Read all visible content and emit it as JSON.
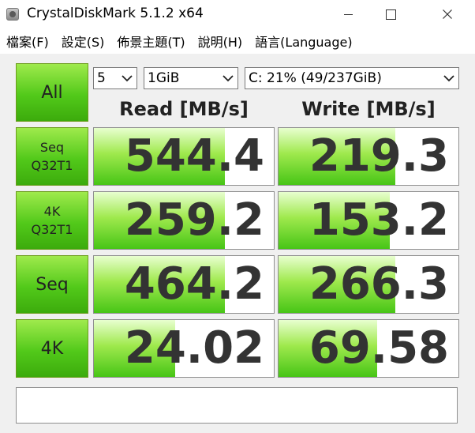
{
  "window": {
    "title": "CrystalDiskMark 5.1.2 x64"
  },
  "menu": [
    {
      "label": "檔案(F)"
    },
    {
      "label": "設定(S)"
    },
    {
      "label": "佈景主題(T)"
    },
    {
      "label": "說明(H)"
    },
    {
      "label": "語言(Language)"
    }
  ],
  "controls": {
    "all_label": "All",
    "count": "5",
    "size": "1GiB",
    "drive": "C: 21% (49/237GiB)"
  },
  "columns": {
    "read": "Read [MB/s]",
    "write": "Write [MB/s]"
  },
  "tests": [
    {
      "label": [
        "Seq",
        "Q32T1"
      ],
      "read": "544.4",
      "write": "219.3",
      "read_fill": 0.73,
      "write_fill": 0.65
    },
    {
      "label": [
        "4K",
        "Q32T1"
      ],
      "read": "259.2",
      "write": "153.2",
      "read_fill": 0.73,
      "write_fill": 0.62
    },
    {
      "label": [
        "Seq"
      ],
      "read": "464.2",
      "write": "266.3",
      "read_fill": 0.73,
      "write_fill": 0.65
    },
    {
      "label": [
        "4K"
      ],
      "read": "24.02",
      "write": "69.58",
      "read_fill": 0.45,
      "write_fill": 0.55
    }
  ],
  "status": "",
  "colors": {
    "accent_green": "#52c91a",
    "value_text": "#333333"
  },
  "icons": {
    "app": "crystaldiskmark-icon",
    "dropdown": "chevron-down-icon"
  }
}
